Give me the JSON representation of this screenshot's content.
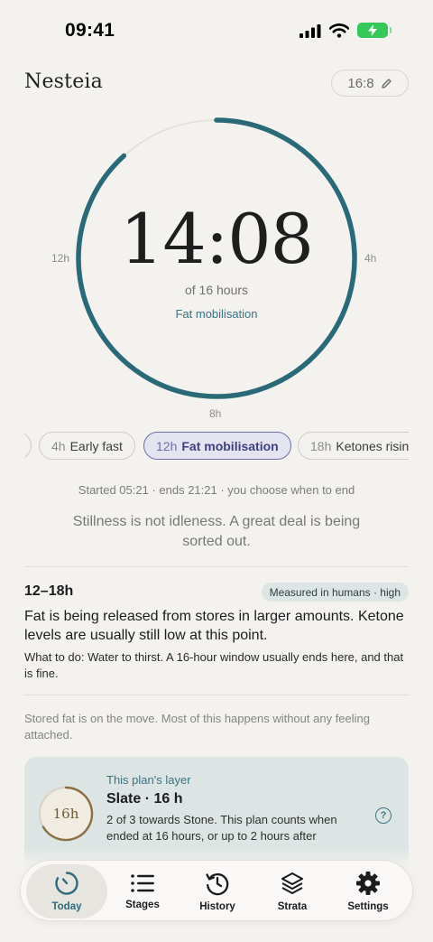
{
  "status_bar": {
    "time": "09:41"
  },
  "header": {
    "app_title": "Nesteia",
    "plan_label": "16:8",
    "edit_icon": "pencil-icon"
  },
  "timer": {
    "elapsed": "14:08",
    "target_text": "of 16 hours",
    "current_stage": "Fat mobilisation",
    "progress_fraction": 0.883,
    "ring_labels": {
      "left": "12h",
      "right": "4h",
      "bottom": "8h"
    }
  },
  "stages": [
    {
      "hours": "",
      "name": ""
    },
    {
      "hours": "4h",
      "name": "Early fast"
    },
    {
      "hours": "12h",
      "name": "Fat mobilisation",
      "active": true
    },
    {
      "hours": "18h",
      "name": "Ketones rising"
    }
  ],
  "session": {
    "started_text": "Started 05:21 · ends 21:21 · you choose when to end",
    "quote": "Stillness is not idleness. A great deal is being sorted out."
  },
  "stage_detail": {
    "range": "12–18h",
    "evidence": "Measured in humans · high",
    "body": "Fat is being released from stores in larger amounts. Ketone levels are usually still low at this point.",
    "what_to_do": "What to do: Water to thirst. A 16-hour window usually ends here, and that is fine.",
    "footnote": "Stored fat is on the move. Most of this happens without any feeling attached."
  },
  "layer_card": {
    "eyebrow": "This plan's layer",
    "title": "Slate · 16 h",
    "badge": "16h",
    "description": "2 of 3 towards Stone. This plan counts when ended at 16 hours, or up to 2 hours after",
    "help_icon": "?"
  },
  "tabbar": {
    "tabs": [
      {
        "label": "Today",
        "icon": "clock-icon",
        "active": true
      },
      {
        "label": "Stages",
        "icon": "list-icon"
      },
      {
        "label": "History",
        "icon": "history-icon"
      },
      {
        "label": "Strata",
        "icon": "layers-icon"
      },
      {
        "label": "Settings",
        "icon": "gear-icon"
      }
    ]
  },
  "colors": {
    "accent": "#2a6978",
    "background": "#f4f2ee",
    "active_chip": "#6c6ea6",
    "card": "#dce5e4"
  }
}
